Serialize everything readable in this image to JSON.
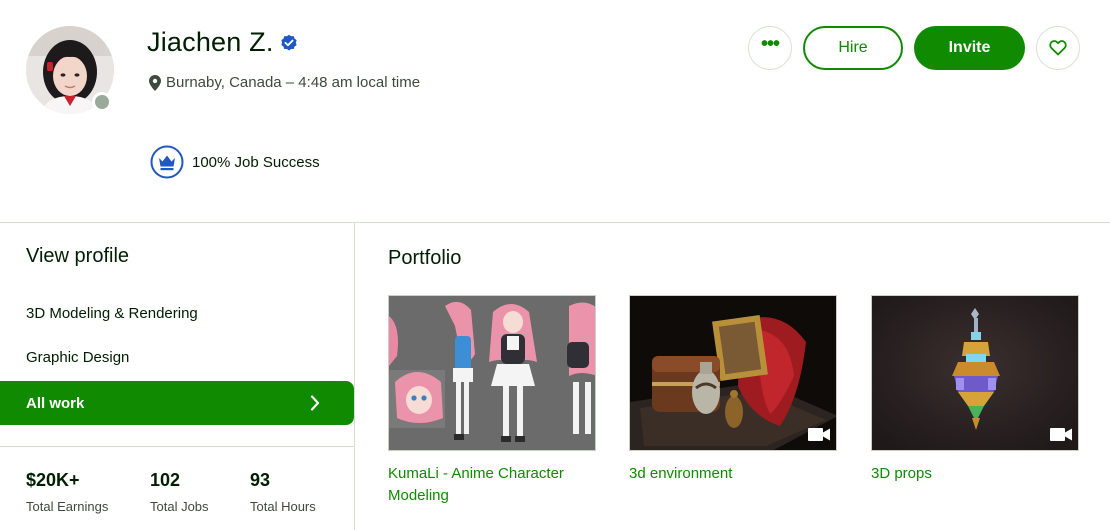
{
  "profile": {
    "name": "Jiachen Z.",
    "location": "Burnaby, Canada – 4:48 am local time",
    "job_success": "100% Job Success"
  },
  "actions": {
    "more_label": "•••",
    "hire_label": "Hire",
    "invite_label": "Invite"
  },
  "sidebar": {
    "title": "View profile",
    "items": [
      {
        "label": "3D Modeling & Rendering"
      },
      {
        "label": "Graphic Design"
      },
      {
        "label": "All work",
        "active": true
      }
    ]
  },
  "stats": [
    {
      "value": "$20K+",
      "label": "Total Earnings"
    },
    {
      "value": "102",
      "label": "Total Jobs"
    },
    {
      "value": "93",
      "label": "Total Hours"
    }
  ],
  "portfolio": {
    "title": "Portfolio",
    "items": [
      {
        "title": "KumaLi - Anime Character Modeling",
        "video": false
      },
      {
        "title": "3d environment",
        "video": true
      },
      {
        "title": "3D props",
        "video": true
      }
    ]
  },
  "colors": {
    "accent": "#108a00",
    "text": "#001e00",
    "verified": "#1f57c3",
    "online_dot": "#9aaa9a"
  },
  "icons": [
    "verified-badge-icon",
    "location-pin-icon",
    "crown-badge-icon",
    "more-icon",
    "heart-icon",
    "chevron-right-icon",
    "video-icon"
  ]
}
